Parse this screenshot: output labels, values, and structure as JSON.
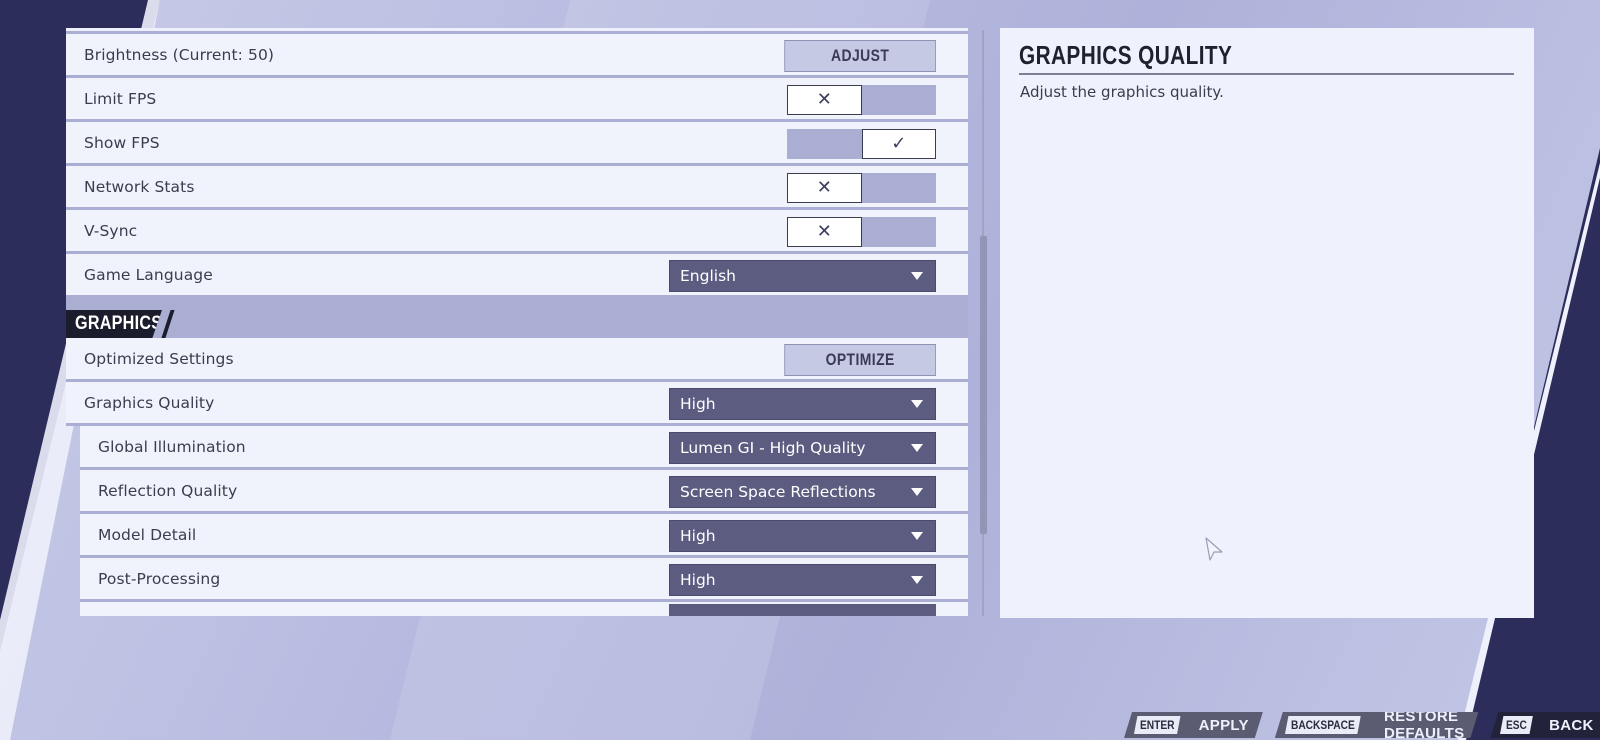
{
  "colors": {
    "row_bg": "#f1f3fc",
    "row_separator": "#a9aed2",
    "dropdown_bg": "#5b5c80",
    "section_bg": "#a9aed2",
    "section_tag_bg": "#1c1d2c",
    "button_bg": "#c5c9e4",
    "panel_bg": "#eff2fc",
    "background_dark": "#2c2d5a"
  },
  "settings": {
    "general_rows": [
      {
        "label": "Brightness (Current: 50)",
        "control": "button",
        "button_label": "ADJUST"
      },
      {
        "label": "Limit FPS",
        "control": "toggle",
        "value": false
      },
      {
        "label": "Show FPS",
        "control": "toggle",
        "value": true
      },
      {
        "label": "Network Stats",
        "control": "toggle",
        "value": false
      },
      {
        "label": "V-Sync",
        "control": "toggle",
        "value": false
      },
      {
        "label": "Game Language",
        "control": "dropdown",
        "value": "English"
      }
    ],
    "graphics_section": {
      "title": "GRAPHICS",
      "rows": [
        {
          "label": "Optimized Settings",
          "control": "button",
          "button_label": "OPTIMIZE"
        },
        {
          "label": "Graphics Quality",
          "control": "dropdown",
          "value": "High"
        },
        {
          "label": "Global Illumination",
          "control": "dropdown",
          "value": "Lumen GI - High Quality",
          "sub": true
        },
        {
          "label": "Reflection Quality",
          "control": "dropdown",
          "value": "Screen Space Reflections",
          "sub": true
        },
        {
          "label": "Model Detail",
          "control": "dropdown",
          "value": "High",
          "sub": true
        },
        {
          "label": "Post-Processing",
          "control": "dropdown",
          "value": "High",
          "sub": true
        }
      ]
    }
  },
  "toggle_glyphs": {
    "off": "✕",
    "on": "✓"
  },
  "description": {
    "title": "GRAPHICS QUALITY",
    "text": "Adjust the graphics quality."
  },
  "footer": {
    "hints": [
      {
        "key": "ENTER",
        "action": "APPLY"
      },
      {
        "key": "BACKSPACE",
        "action": "RESTORE DEFAULTS"
      },
      {
        "key": "ESC",
        "action": "BACK"
      }
    ]
  }
}
